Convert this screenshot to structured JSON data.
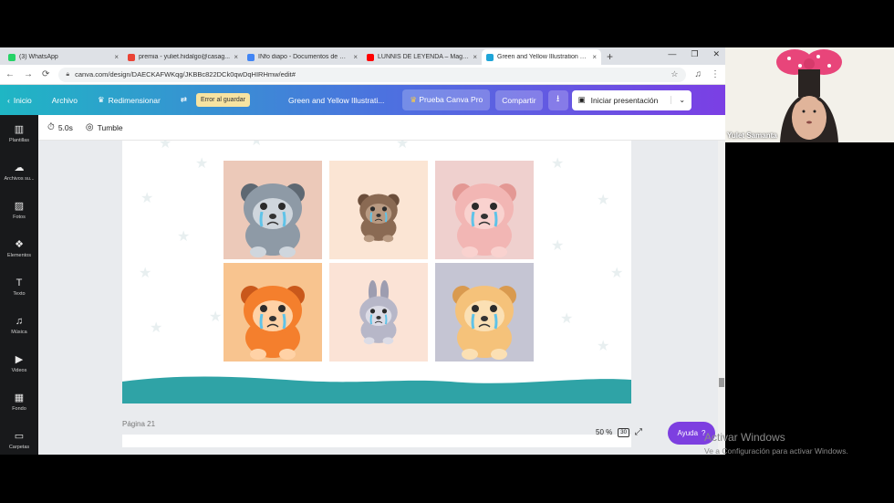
{
  "browser": {
    "tabs": [
      {
        "title": "(3) WhatsApp",
        "color": "#25d366",
        "active": false
      },
      {
        "title": "premia - yuliet.hidalgo@casag...",
        "color": "#ea4335",
        "active": false
      },
      {
        "title": "INfo diapo - Documentos de G...",
        "color": "#4285f4",
        "active": false
      },
      {
        "title": "LUNNIS DE LEYENDA – Magal...",
        "color": "#ff0000",
        "active": false
      },
      {
        "title": "Green and Yellow Illustration B...",
        "color": "#1fa5d8",
        "active": true
      }
    ],
    "new_tab": "+",
    "close": "×",
    "url": "canva.com/design/DAECKAFWKqg/JKBBc822DCk0qwDqHIRHmw/edit#"
  },
  "canva_bar": {
    "home": "Inicio",
    "file": "Archivo",
    "resize": "Redimensionar",
    "save_error": "Error al guardar",
    "title": "Green and Yellow Illustrati...",
    "pro": "Prueba Canva Pro",
    "share": "Compartir",
    "present": "Iniciar presentación"
  },
  "sidebar": {
    "items": [
      {
        "label": "Plantillas",
        "icon": "templates-icon",
        "glyph": "▥"
      },
      {
        "label": "Archivos su...",
        "icon": "upload-cloud-icon",
        "glyph": "☁"
      },
      {
        "label": "Fotos",
        "icon": "photos-icon",
        "glyph": "▨"
      },
      {
        "label": "Elementos",
        "icon": "elements-icon",
        "glyph": "❖"
      },
      {
        "label": "Texto",
        "icon": "text-icon",
        "glyph": "T"
      },
      {
        "label": "Música",
        "icon": "music-icon",
        "glyph": "♫"
      },
      {
        "label": "Videos",
        "icon": "video-icon",
        "glyph": "▶"
      },
      {
        "label": "Fondo",
        "icon": "background-icon",
        "glyph": "▦"
      },
      {
        "label": "Carpetas",
        "icon": "folder-icon",
        "glyph": "▭"
      }
    ]
  },
  "editor_toolbar": {
    "duration": "5.0s",
    "transition": "Tumble"
  },
  "canvas": {
    "page_label": "Página 21",
    "zoom": "50 %",
    "page_count": "30",
    "help": "Ayuda",
    "help_glyph": "?",
    "tiles": [
      {
        "animal": "raccoon",
        "bg": "#ecc9b9"
      },
      {
        "animal": "bear",
        "bg": "#fbe5d4"
      },
      {
        "animal": "cat",
        "bg": "#efd0ce"
      },
      {
        "animal": "tiger",
        "bg": "#f8c48f"
      },
      {
        "animal": "bunny",
        "bg": "#fbe3d6"
      },
      {
        "animal": "dog",
        "bg": "#c5c5d3"
      }
    ],
    "wave_color": "#2fa3a6"
  },
  "webcam": {
    "name": "Yulet Samanta"
  },
  "windows_watermark": {
    "title": "Activar Windows",
    "subtitle": "Ve a Configuración para activar Windows."
  }
}
